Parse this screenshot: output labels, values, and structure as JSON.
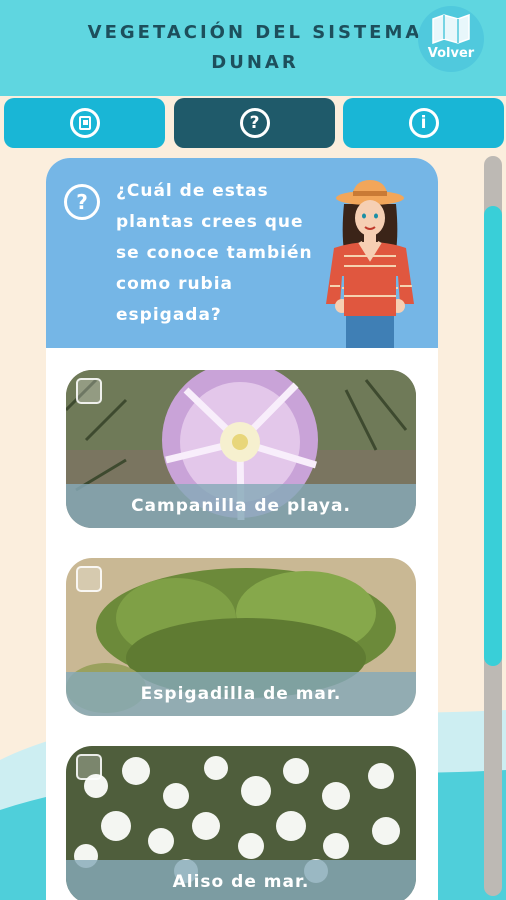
{
  "header": {
    "title_line1": "VEGETACIÓN DEL SISTEMA",
    "title_line2": "DUNAR",
    "back_label": "Volver"
  },
  "tabs": [
    {
      "icon": "book-icon"
    },
    {
      "icon": "question-icon",
      "glyph": "?"
    },
    {
      "icon": "info-icon",
      "glyph": "i"
    }
  ],
  "question": {
    "icon_glyph": "?",
    "line1": "¿Cuál de estas",
    "line2": "plantas crees que",
    "line3": "se conoce también",
    "line4": "como rubia",
    "line5": "espigada?"
  },
  "options": [
    {
      "label": "Campanilla de playa."
    },
    {
      "label": "Espigadilla de mar."
    },
    {
      "label": "Aliso de mar."
    }
  ],
  "colors": {
    "header": "#5fd6e0",
    "tab": "#19b6d6",
    "tab_active": "#1f5a6a",
    "question_panel": "#75b6e6",
    "scroll_thumb": "#39cfd8"
  }
}
